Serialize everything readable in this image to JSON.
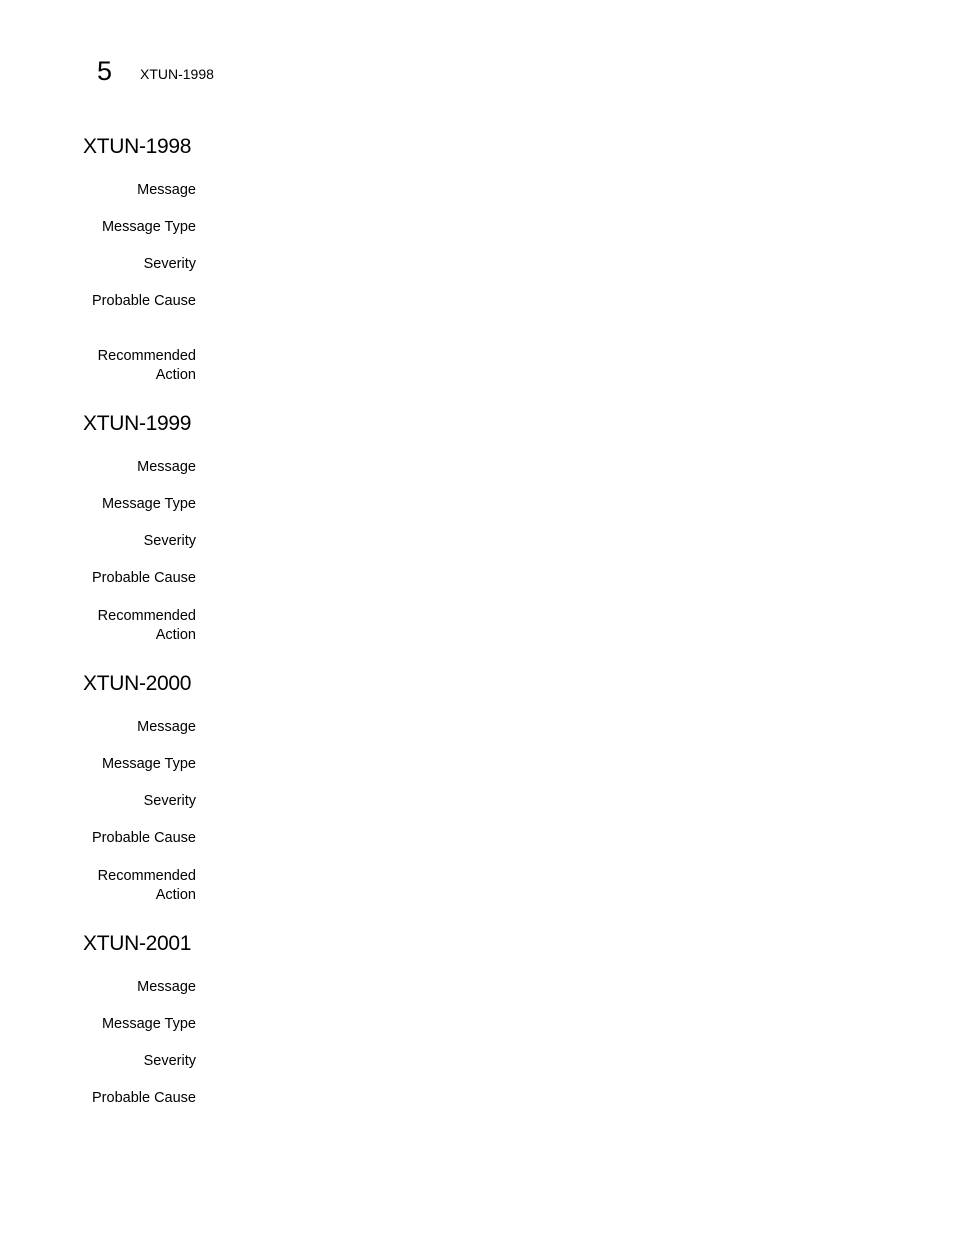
{
  "header": {
    "chapter_number": "5",
    "running_title": "XTUN-1998"
  },
  "entries": [
    {
      "title": "XTUN-1998",
      "fields": [
        "Message",
        "Message Type",
        "Severity",
        "Probable Cause",
        "Recommended",
        "Action"
      ]
    },
    {
      "title": "XTUN-1999",
      "fields": [
        "Message",
        "Message Type",
        "Severity",
        "Probable Cause",
        "Recommended",
        "Action"
      ]
    },
    {
      "title": "XTUN-2000",
      "fields": [
        "Message",
        "Message Type",
        "Severity",
        "Probable Cause",
        "Recommended",
        "Action"
      ]
    },
    {
      "title": "XTUN-2001",
      "fields": [
        "Message",
        "Message Type",
        "Severity",
        "Probable Cause"
      ]
    }
  ]
}
